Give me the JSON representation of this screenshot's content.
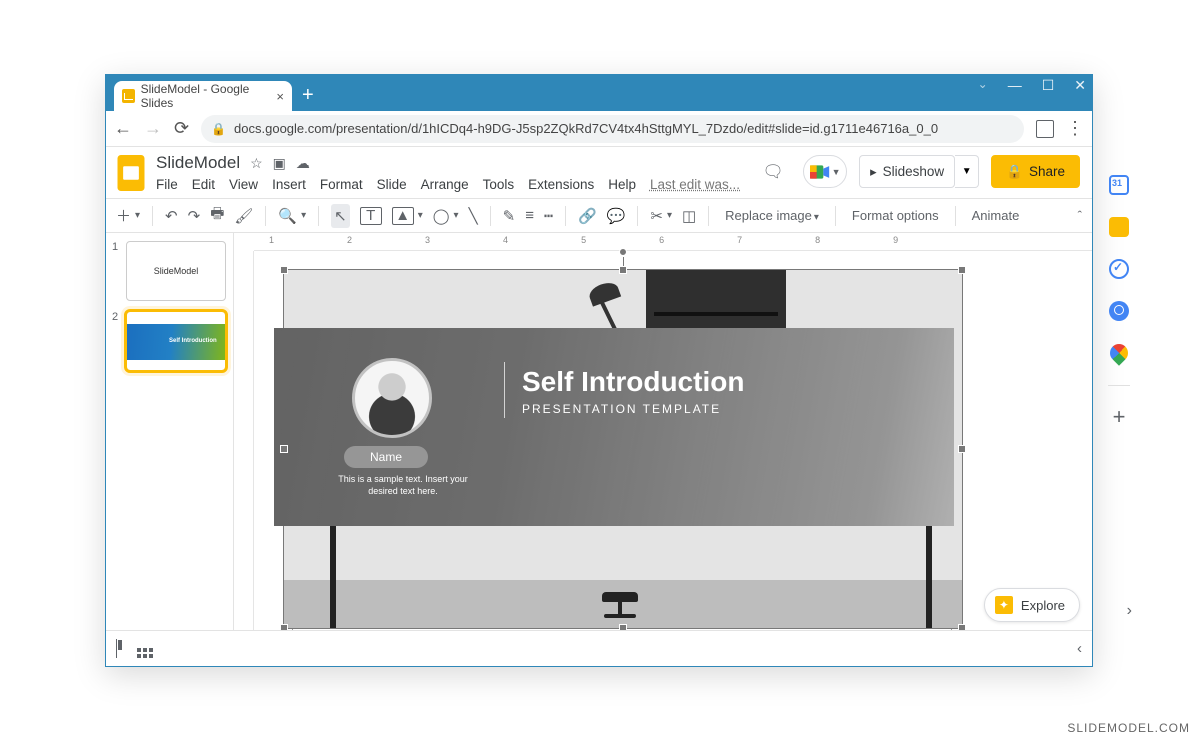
{
  "browser": {
    "tab_title": "SlideModel - Google Slides",
    "url": "docs.google.com/presentation/d/1hICDq4-h9DG-J5sp2ZQkRd7CV4tx4hSttgMYL_7Dzdo/edit#slide=id.g1711e46716a_0_0"
  },
  "doc": {
    "name": "SlideModel",
    "last_edit": "Last edit was..."
  },
  "menus": {
    "file": "File",
    "edit": "Edit",
    "view": "View",
    "insert": "Insert",
    "format": "Format",
    "slide": "Slide",
    "arrange": "Arrange",
    "tools": "Tools",
    "extensions": "Extensions",
    "help": "Help"
  },
  "header_buttons": {
    "slideshow": "Slideshow",
    "share": "Share"
  },
  "toolbar": {
    "replace_image": "Replace image",
    "format_options": "Format options",
    "animate": "Animate"
  },
  "thumbnails": {
    "s1": {
      "num": "1",
      "label": "SlideModel"
    },
    "s2": {
      "num": "2",
      "title": "Self Introduction"
    }
  },
  "slide": {
    "title": "Self Introduction",
    "subtitle": "PRESENTATION TEMPLATE",
    "name_pill": "Name",
    "sample_text": "This is a sample text. Insert your desired text here."
  },
  "explore": "Explore",
  "ruler": {
    "t1": "1",
    "t2": "2",
    "t3": "3",
    "t4": "4",
    "t5": "5",
    "t6": "6",
    "t7": "7",
    "t8": "8",
    "t9": "9"
  },
  "watermark": "SLIDEMODEL.COM"
}
